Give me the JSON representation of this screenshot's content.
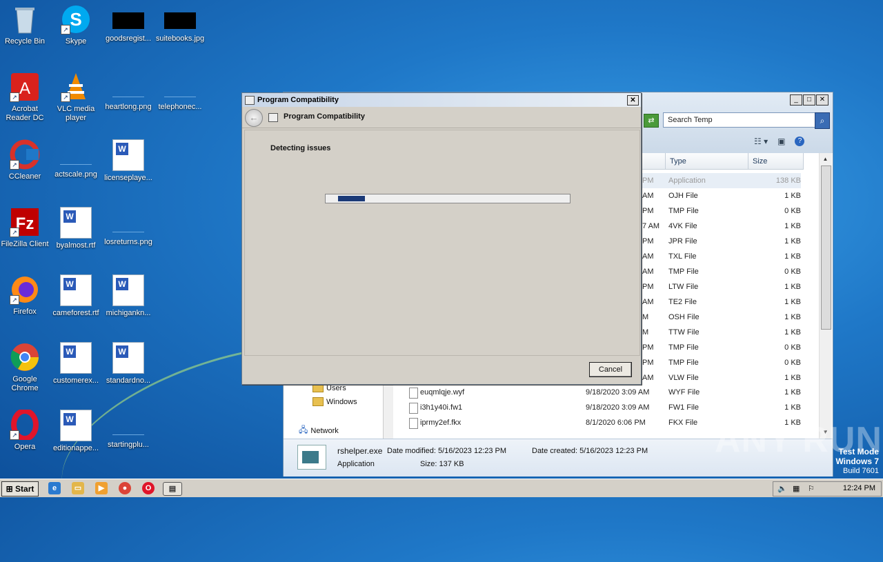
{
  "desktop": {
    "icons": [
      {
        "label": "Recycle Bin"
      },
      {
        "label": "Skype"
      },
      {
        "label": "goodsregist..."
      },
      {
        "label": "suitebooks.jpg"
      },
      {
        "label": "Acrobat Reader DC"
      },
      {
        "label": "VLC media player"
      },
      {
        "label": "heartlong.png"
      },
      {
        "label": "telephonec..."
      },
      {
        "label": "CCleaner"
      },
      {
        "label": "actscale.png"
      },
      {
        "label": "licenseplaye..."
      },
      {
        "label": "FileZilla Client"
      },
      {
        "label": "byalmost.rtf"
      },
      {
        "label": "losreturns.png"
      },
      {
        "label": "Firefox"
      },
      {
        "label": "cameforest.rtf"
      },
      {
        "label": "michigankn..."
      },
      {
        "label": "Google Chrome"
      },
      {
        "label": "customerex..."
      },
      {
        "label": "standardno..."
      },
      {
        "label": "Opera"
      },
      {
        "label": "editionappe..."
      },
      {
        "label": "startingplu..."
      }
    ]
  },
  "explorer": {
    "search_placeholder": "Search Temp",
    "columns": {
      "type": "Type",
      "size": "Size"
    },
    "top_rows": [
      {
        "time": "PM",
        "type": "Application",
        "size": "138 KB"
      },
      {
        "time": "AM",
        "type": "OJH File",
        "size": "1 KB"
      },
      {
        "time": "PM",
        "type": "TMP File",
        "size": "0 KB"
      },
      {
        "time": "7 AM",
        "type": "4VK File",
        "size": "1 KB"
      },
      {
        "time": "PM",
        "type": "JPR File",
        "size": "1 KB"
      },
      {
        "time": "AM",
        "type": "TXL File",
        "size": "1 KB"
      },
      {
        "time": "AM",
        "type": "TMP File",
        "size": "0 KB"
      },
      {
        "time": "PM",
        "type": "LTW File",
        "size": "1 KB"
      },
      {
        "time": "AM",
        "type": "TE2 File",
        "size": "1 KB"
      },
      {
        "time": "M",
        "type": "OSH File",
        "size": "1 KB"
      },
      {
        "time": "M",
        "type": "TTW File",
        "size": "1 KB"
      },
      {
        "time": "PM",
        "type": "TMP File",
        "size": "0 KB"
      },
      {
        "time": "PM",
        "type": "TMP File",
        "size": "0 KB"
      },
      {
        "time": "AM",
        "type": "VLW File",
        "size": "1 KB"
      }
    ],
    "nav": {
      "users": "Users",
      "windows": "Windows",
      "network": "Network"
    },
    "bottom_rows": [
      {
        "name": "euqmlqje.wyf",
        "date": "9/18/2020 3:09 AM",
        "type": "WYF File",
        "size": "1 KB"
      },
      {
        "name": "i3h1y40i.fw1",
        "date": "9/18/2020 3:09 AM",
        "type": "FW1 File",
        "size": "1 KB"
      },
      {
        "name": "iprmy2ef.fkx",
        "date": "8/1/2020 6:06 PM",
        "type": "FKX File",
        "size": "1 KB"
      }
    ],
    "details": {
      "name": "rshelper.exe",
      "modified": "Date modified: 5/16/2023 12:23 PM",
      "created": "Date created: 5/16/2023 12:23 PM",
      "kind": "Application",
      "size": "Size: 137 KB"
    }
  },
  "dialog": {
    "title": "Program Compatibility",
    "header": "Program Compatibility",
    "status": "Detecting issues",
    "progress_fraction": 0.11,
    "cancel_label": "Cancel"
  },
  "taskbar": {
    "start_label": "Start",
    "clock": "12:24 PM"
  },
  "watermark": {
    "text": "ANY RUN",
    "test_mode": "Test Mode",
    "os": "Windows 7",
    "build": "Build 7601"
  }
}
